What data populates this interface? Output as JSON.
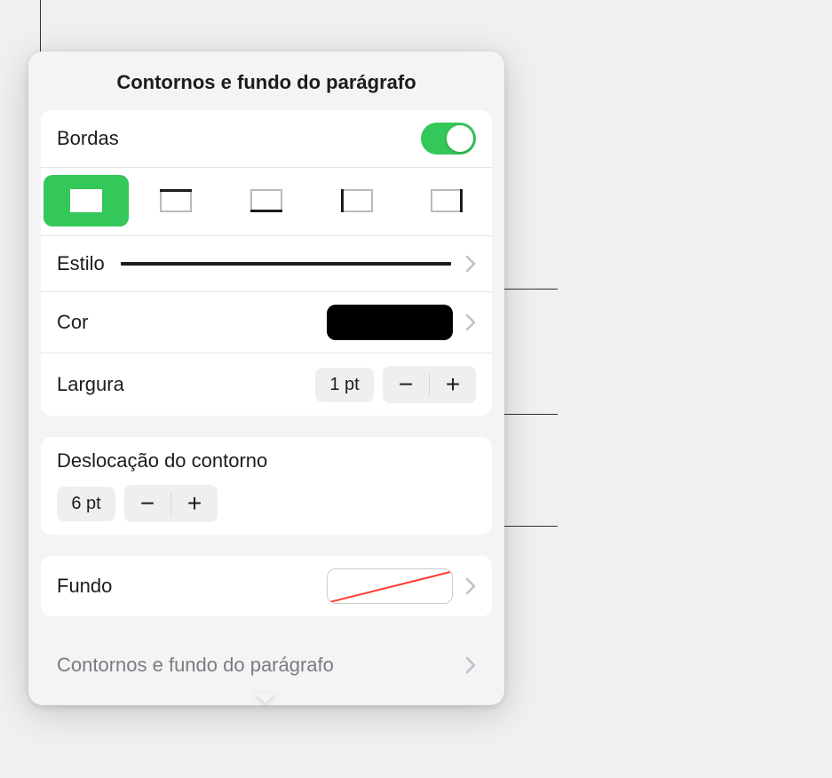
{
  "popover": {
    "title": "Contornos e fundo do parágrafo"
  },
  "borders": {
    "label": "Bordas",
    "toggle_on": true,
    "segments": [
      {
        "name": "border-all",
        "active": true
      },
      {
        "name": "border-top",
        "active": false
      },
      {
        "name": "border-bottom",
        "active": false
      },
      {
        "name": "border-left",
        "active": false
      },
      {
        "name": "border-right",
        "active": false
      }
    ],
    "style": {
      "label": "Estilo",
      "preview": "solid"
    },
    "color": {
      "label": "Cor",
      "value": "#000000"
    },
    "width": {
      "label": "Largura",
      "value": "1 pt"
    }
  },
  "offset": {
    "label": "Deslocação do contorno",
    "value": "6 pt"
  },
  "background": {
    "label": "Fundo",
    "value": "none"
  },
  "footer": {
    "label": "Contornos e fundo do parágrafo"
  },
  "icons": {
    "minus": "−",
    "plus": "+"
  }
}
